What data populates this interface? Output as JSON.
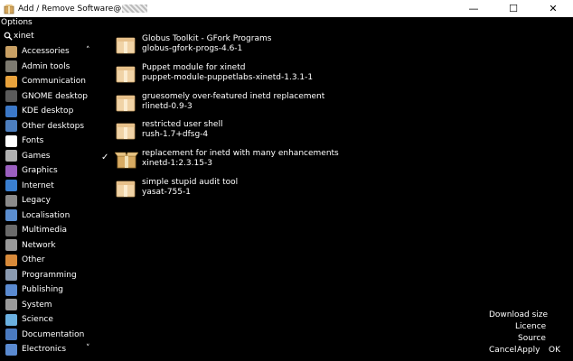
{
  "window": {
    "title": "Add / Remove Software@",
    "controls": {
      "minimize": "—",
      "maximize": "☐",
      "close": "✕"
    }
  },
  "menubar": {
    "options": "Options"
  },
  "search": {
    "value": "xinet"
  },
  "sidebar": {
    "categories": [
      {
        "label": "Accessories",
        "icon": "accessories-icon",
        "color": "#c9a064"
      },
      {
        "label": "Admin tools",
        "icon": "admin-tools-icon",
        "color": "#7d7a70"
      },
      {
        "label": "Communication",
        "icon": "communication-icon",
        "color": "#e8a23c"
      },
      {
        "label": "GNOME desktop",
        "icon": "gnome-icon",
        "color": "#5a5a5a"
      },
      {
        "label": "KDE desktop",
        "icon": "kde-icon",
        "color": "#3b78c8"
      },
      {
        "label": "Other desktops",
        "icon": "other-desktops-icon",
        "color": "#4d7fbf"
      },
      {
        "label": "Fonts",
        "icon": "fonts-icon",
        "color": "#ffffff"
      },
      {
        "label": "Games",
        "icon": "games-icon",
        "color": "#b0b0b0"
      },
      {
        "label": "Graphics",
        "icon": "graphics-icon",
        "color": "#9b5fc0"
      },
      {
        "label": "Internet",
        "icon": "internet-icon",
        "color": "#3a7fd0"
      },
      {
        "label": "Legacy",
        "icon": "legacy-icon",
        "color": "#8a8a8a"
      },
      {
        "label": "Localisation",
        "icon": "localisation-icon",
        "color": "#5b8ed0"
      },
      {
        "label": "Multimedia",
        "icon": "multimedia-icon",
        "color": "#6a6a6a"
      },
      {
        "label": "Network",
        "icon": "network-icon",
        "color": "#9a9a9a"
      },
      {
        "label": "Other",
        "icon": "other-icon",
        "color": "#d88a3a"
      },
      {
        "label": "Programming",
        "icon": "programming-icon",
        "color": "#8a9ab0"
      },
      {
        "label": "Publishing",
        "icon": "publishing-icon",
        "color": "#5a8ad0"
      },
      {
        "label": "System",
        "icon": "system-icon",
        "color": "#9a9a9a"
      },
      {
        "label": "Science",
        "icon": "science-icon",
        "color": "#6ab0e0"
      },
      {
        "label": "Documentation",
        "icon": "documentation-icon",
        "color": "#4a7ac0"
      },
      {
        "label": "Electronics",
        "icon": "electronics-icon",
        "color": "#5a8ad0"
      }
    ],
    "scroll_up": "˄",
    "scroll_down": "˅"
  },
  "packages": [
    {
      "summary": "Globus Toolkit - GFork Programs",
      "name": "globus-gfork-progs-4.6-1",
      "installed": false
    },
    {
      "summary": "Puppet module for xinetd",
      "name": "puppet-module-puppetlabs-xinetd-1.3.1-1",
      "installed": false
    },
    {
      "summary": "gruesomely over-featured inetd replacement",
      "name": "rlinetd-0.9-3",
      "installed": false
    },
    {
      "summary": "restricted user shell",
      "name": "rush-1.7+dfsg-4",
      "installed": false
    },
    {
      "summary": "replacement for inetd with many enhancements",
      "name": "xinetd-1:2.3.15-3",
      "installed": true
    },
    {
      "summary": "simple stupid audit tool",
      "name": "yasat-755-1",
      "installed": false
    }
  ],
  "check_mark": "✓",
  "details": {
    "download_size": "Download size",
    "licence": "Licence",
    "source": "Source"
  },
  "buttons": {
    "cancel": "Cancel",
    "apply": "Apply",
    "ok": "OK"
  }
}
